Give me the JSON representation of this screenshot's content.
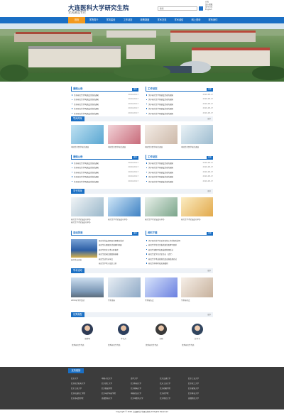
{
  "header": {
    "title": "大连医科大学研究生院",
    "subtitle": "学风建设专栏",
    "search_placeholder": "搜索",
    "top_links": [
      "首页",
      "加入收藏",
      "设为首页",
      "English"
    ]
  },
  "nav": {
    "items": [
      "首页",
      "学院简介",
      "学风建设",
      "工作动态",
      "政策制度",
      "学术交流",
      "学术诚信",
      "网上咨询",
      "联系我们"
    ],
    "active_index": 0
  },
  "sections": {
    "notice": {
      "title": "通知公告",
      "more": "更多"
    },
    "work": {
      "title": "工作动态",
      "more": "更多"
    },
    "teacher": {
      "title": "导师风采",
      "more": "更多"
    },
    "notice2": {
      "title": "通知公告",
      "more": "更多"
    },
    "work2": {
      "title": "工作动态",
      "more": "更多"
    },
    "student": {
      "title": "学子风采",
      "more": "更多"
    },
    "activity": {
      "title": "活动风采",
      "more": "更多"
    },
    "download": {
      "title": "资料下载",
      "more": "更多"
    },
    "academic": {
      "title": "学术活动",
      "more": "更多"
    },
    "model": {
      "title": "优秀典型",
      "more": "更多"
    }
  },
  "news_rows": [
    {
      "title": "关于研究生学风建设活动的通知",
      "date": "2016-08-17"
    },
    {
      "title": "关于研究生学风建设活动的通知",
      "date": "2016-08-17"
    },
    {
      "title": "关于研究生学风建设活动的通知",
      "date": "2016-08-17"
    },
    {
      "title": "关于研究生学风建设活动的通知",
      "date": "2016-08-17"
    },
    {
      "title": "关于研究生学风建设活动的通知",
      "date": "2016-08-17"
    }
  ],
  "teacher_caps": [
    "中国生命医学研究进展",
    "中国生命医学研究进展",
    "中国生命医学研究进展",
    "中国生命医学研究进展"
  ],
  "student_caps": [
    "研究生学术论坛成功举办",
    "研究生学术论坛成功举办",
    "研究生学术论坛成功举办",
    "研究生学术论坛成功举办",
    "研究生学术论坛成功举办"
  ],
  "activity": {
    "caption": "研究生运动会",
    "items": [
      "研究生党支部开展主题教育活动",
      "研究生志愿服务活动顺利开展",
      "研究生文化艺术节开幕式",
      "研究生篮球比赛圆满落幕",
      "研究生读书分享会",
      "研究生学术沙龙第三期"
    ]
  },
  "downloads": [
    "关于研究生学位论文答辩工作的相关说明",
    "研究生学位论文格式规范及撰写要求",
    "研究生课程考核及成绩管理办法",
    "研究生奖学金评定办法（试行）",
    "研究生学术道德规范及违规处理办法",
    "研究生中期考核实施细则"
  ],
  "academic_caps": [
    "2016年学术活动",
    "学术讲座",
    "学术报告会",
    "学术研讨会"
  ],
  "models": [
    {
      "name": "张晓明",
      "desc": "优秀研究生代表"
    },
    {
      "name": "李东方",
      "desc": "优秀研究生代表"
    },
    {
      "name": "王刚",
      "desc": "优秀研究生代表"
    },
    {
      "name": "赵飞飞",
      "desc": "优秀研究生代表"
    }
  ],
  "footer": {
    "tab": "友情链接",
    "links": [
      [
        "北京大学",
        "中国人民大学",
        "清华大学",
        "北京交通大学",
        "北京工业大学"
      ],
      [
        "北京航空航天大学",
        "北京理工大学",
        "北京科技大学",
        "北方工业大学",
        "北京化工大学"
      ],
      [
        "北京工商大学",
        "北京服装学院",
        "北京邮电大学",
        "北京印刷学院",
        "北京建筑大学"
      ],
      [
        "北京石油化工学院",
        "北京电子科技学院",
        "中国农业大学",
        "北京农学院",
        "北京林业大学"
      ],
      [
        "北京协和医学院",
        "首都医科大学",
        "北京中医药大学",
        "北京师范大学",
        "首都师范大学"
      ]
    ],
    "copyright": "Copyright © 2016 大连医科大学研究生院 All Rights Reserved"
  },
  "colors": {
    "brand": "#1a6fc4",
    "accent": "#f39a1d",
    "footer": "#3c3c3c"
  }
}
